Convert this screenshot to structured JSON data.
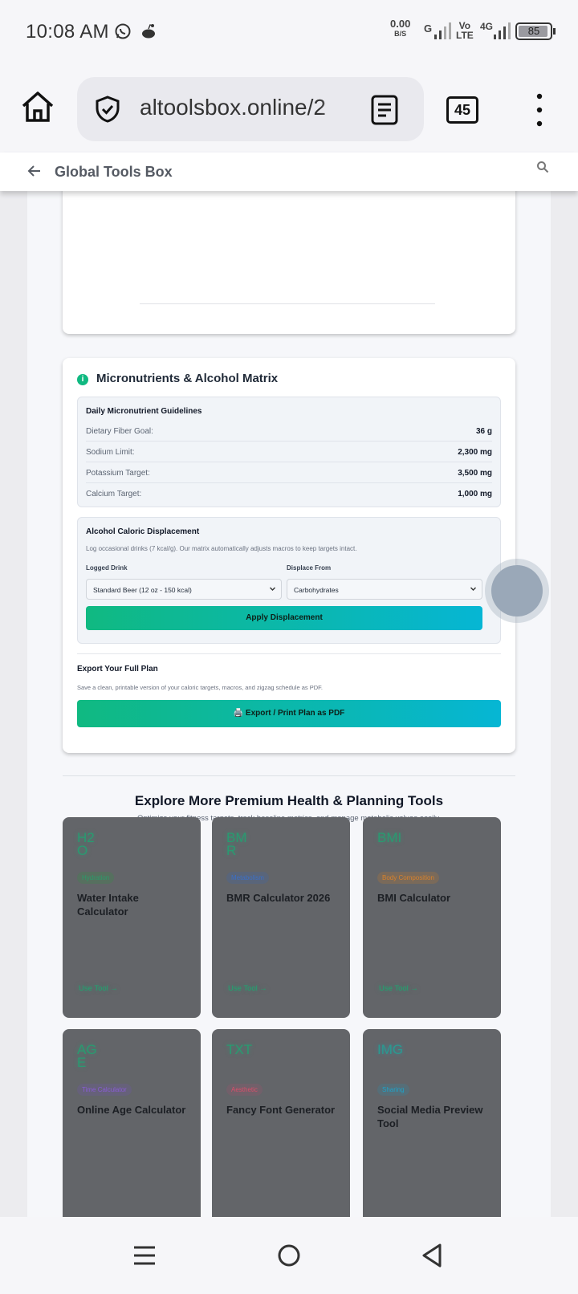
{
  "status": {
    "time": "10:08 AM",
    "net_speed_value": "0.00",
    "net_speed_unit": "B/S",
    "network_g": "G",
    "volte_top": "Vo",
    "volte_bottom": "LTE",
    "network_4g": "4G",
    "battery": "85"
  },
  "browser": {
    "url": "altoolsbox.online/2",
    "tab_count": "45"
  },
  "site": {
    "title": "Global Tools Box"
  },
  "micro": {
    "title": "Micronutrients & Alcohol Matrix",
    "info_glyph": "i",
    "guidelines_title": "Daily Micronutrient Guidelines",
    "rows": [
      {
        "label": "Dietary Fiber Goal:",
        "value": "36 g"
      },
      {
        "label": "Sodium Limit:",
        "value": "2,300 mg"
      },
      {
        "label": "Potassium Target:",
        "value": "3,500 mg"
      },
      {
        "label": "Calcium Target:",
        "value": "1,000 mg"
      }
    ],
    "alcohol_title": "Alcohol Caloric Displacement",
    "alcohol_desc": "Log occasional drinks (7 kcal/g). Our matrix automatically adjusts macros to keep targets intact.",
    "logged_drink_label": "Logged Drink",
    "logged_drink_value": "Standard Beer (12 oz - 150 kcal)",
    "displace_from_label": "Displace From",
    "displace_from_value": "Carbohydrates",
    "apply_label": "Apply Displacement",
    "export_title": "Export Your Full Plan",
    "export_desc": "Save a clean, printable version of your caloric targets, macros, and zigzag schedule as PDF.",
    "export_label": "🖨️ Export / Print Plan as PDF"
  },
  "explore": {
    "title": "Explore More Premium Health & Planning Tools",
    "subtitle": "Optimize your fitness targets, track baseline metrics, and manage metabolic values easily.",
    "tools": [
      {
        "code": "H2O",
        "badge": "Hydration",
        "name": "Water Intake Calculator",
        "cta": "Use Tool →",
        "badge_color": "#2b9b6a",
        "badge_bg": "#56705f"
      },
      {
        "code": "BMR",
        "badge": "Metabolism",
        "name": "BMR Calculator 2026",
        "cta": "Use Tool →",
        "badge_color": "#3b6fc7",
        "badge_bg": "#59657a"
      },
      {
        "code": "BMI",
        "badge": "Body Composition",
        "name": "BMI Calculator",
        "cta": "Use Tool →",
        "badge_color": "#d9822b",
        "badge_bg": "#7a6a5a"
      },
      {
        "code": "AGE",
        "badge": "Time Calculator",
        "name": "Online Age Calculator",
        "cta": "",
        "badge_color": "#8a5cd6",
        "badge_bg": "#66617a"
      },
      {
        "code": "TXT",
        "badge": "Aesthetic",
        "name": "Fancy Font Generator",
        "cta": "",
        "badge_color": "#d94f6a",
        "badge_bg": "#72606a"
      },
      {
        "code": "IMG",
        "badge": "Sharing",
        "name": "Social Media Preview Tool",
        "cta": "",
        "badge_color": "#1ea3c9",
        "badge_bg": "#566e78"
      }
    ]
  }
}
